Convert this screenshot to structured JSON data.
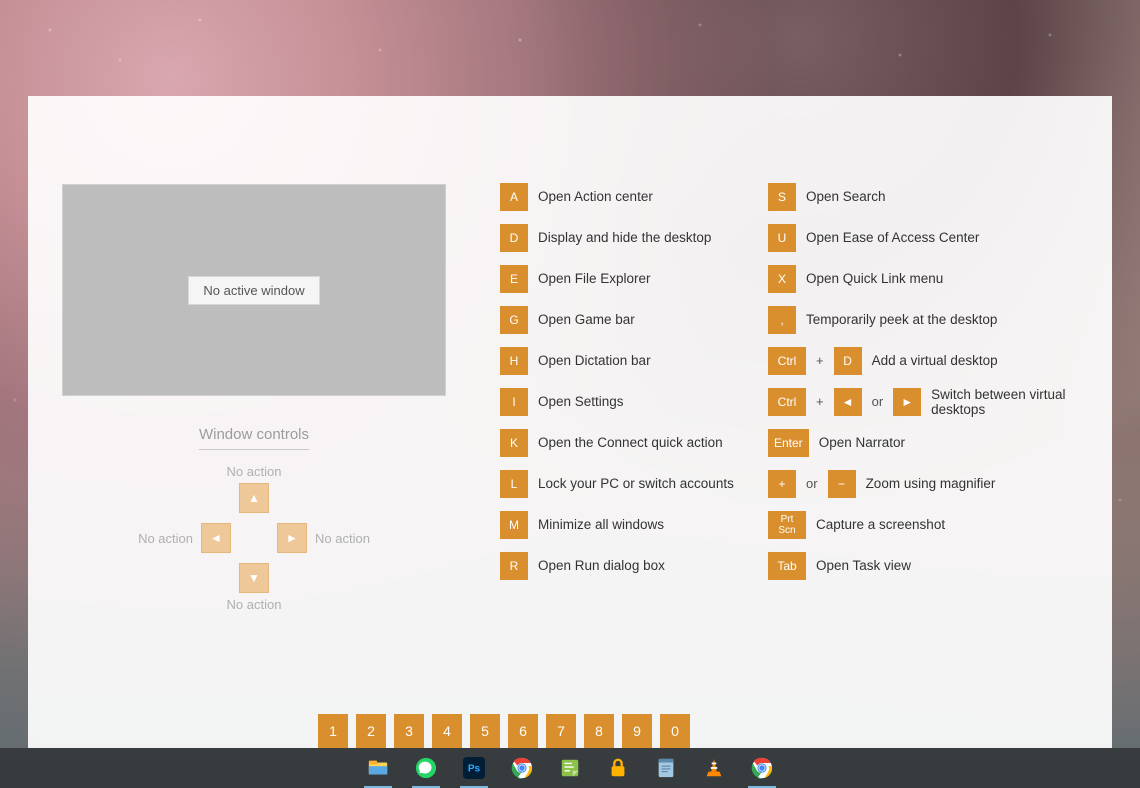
{
  "preview": {
    "no_window": "No active window"
  },
  "window_controls": {
    "title": "Window controls",
    "up": "No action",
    "down": "No action",
    "left": "No action",
    "right": "No action"
  },
  "shortcuts_a": [
    {
      "keys": [
        "A"
      ],
      "desc": "Open Action center"
    },
    {
      "keys": [
        "D"
      ],
      "desc": "Display and hide the desktop"
    },
    {
      "keys": [
        "E"
      ],
      "desc": "Open File Explorer"
    },
    {
      "keys": [
        "G"
      ],
      "desc": "Open Game bar"
    },
    {
      "keys": [
        "H"
      ],
      "desc": "Open Dictation bar"
    },
    {
      "keys": [
        "I"
      ],
      "desc": "Open Settings"
    },
    {
      "keys": [
        "K"
      ],
      "desc": "Open the Connect quick action"
    },
    {
      "keys": [
        "L"
      ],
      "desc": "Lock your PC or switch accounts"
    },
    {
      "keys": [
        "M"
      ],
      "desc": "Minimize all windows"
    },
    {
      "keys": [
        "R"
      ],
      "desc": "Open Run dialog box"
    }
  ],
  "shortcuts_b": [
    {
      "parts": [
        {
          "k": "S"
        }
      ],
      "desc": "Open Search"
    },
    {
      "parts": [
        {
          "k": "U"
        }
      ],
      "desc": "Open Ease of Access Center"
    },
    {
      "parts": [
        {
          "k": "X"
        }
      ],
      "desc": "Open Quick Link menu"
    },
    {
      "parts": [
        {
          "k": ","
        }
      ],
      "desc": "Temporarily peek at the desktop"
    },
    {
      "parts": [
        {
          "k": "Ctrl",
          "w": true
        },
        {
          "t": "+"
        },
        {
          "k": "D"
        }
      ],
      "desc": "Add a virtual desktop"
    },
    {
      "parts": [
        {
          "k": "Ctrl",
          "w": true
        },
        {
          "t": "+"
        },
        {
          "k": "◄"
        },
        {
          "t": "or"
        },
        {
          "k": "►"
        }
      ],
      "desc": "Switch between virtual desktops"
    },
    {
      "parts": [
        {
          "k": "Enter",
          "w": true
        }
      ],
      "desc": "Open Narrator"
    },
    {
      "parts": [
        {
          "k": "+"
        },
        {
          "t": "or"
        },
        {
          "k": "−"
        }
      ],
      "desc": "Zoom using magnifier"
    },
    {
      "parts": [
        {
          "k": "Prt Scn",
          "w": true
        }
      ],
      "desc": "Capture a screenshot"
    },
    {
      "parts": [
        {
          "k": "Tab",
          "w": true
        }
      ],
      "desc": "Open Task view"
    }
  ],
  "number_keys": [
    "1",
    "2",
    "3",
    "4",
    "5",
    "6",
    "7",
    "8",
    "9",
    "0"
  ],
  "taskbar": [
    {
      "name": "file-explorer",
      "active": true
    },
    {
      "name": "whatsapp",
      "active": true
    },
    {
      "name": "photoshop",
      "active": true
    },
    {
      "name": "chrome",
      "active": false
    },
    {
      "name": "sticky-notes",
      "active": false
    },
    {
      "name": "lock-app",
      "active": false
    },
    {
      "name": "notepad",
      "active": false
    },
    {
      "name": "vlc",
      "active": false
    },
    {
      "name": "chrome-2",
      "active": true
    }
  ]
}
